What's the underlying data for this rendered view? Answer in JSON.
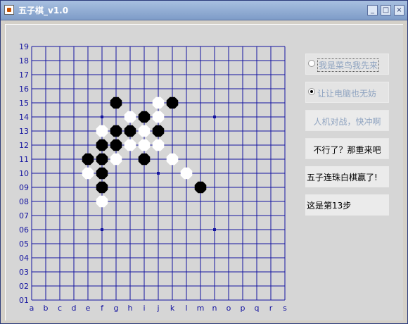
{
  "window": {
    "title": "五子棋_v1.0",
    "minimize": "_",
    "maximize": "□",
    "close": "×"
  },
  "board": {
    "size": 19,
    "row_labels": [
      "19",
      "18",
      "17",
      "16",
      "15",
      "14",
      "13",
      "12",
      "11",
      "10",
      "09",
      "08",
      "07",
      "06",
      "05",
      "04",
      "03",
      "02",
      "01"
    ],
    "col_labels": [
      "a",
      "b",
      "c",
      "d",
      "e",
      "f",
      "g",
      "h",
      "i",
      "j",
      "k",
      "l",
      "m",
      "n",
      "o",
      "p",
      "q",
      "r",
      "s"
    ],
    "line_color": "#1414a0",
    "star_points": [
      "f14",
      "n14",
      "j10",
      "f6",
      "n6"
    ],
    "stones": [
      {
        "pos": "g15",
        "color": "black"
      },
      {
        "pos": "j15",
        "color": "white"
      },
      {
        "pos": "k15",
        "color": "black"
      },
      {
        "pos": "h14",
        "color": "white"
      },
      {
        "pos": "i14",
        "color": "black"
      },
      {
        "pos": "j14",
        "color": "white"
      },
      {
        "pos": "f13",
        "color": "white"
      },
      {
        "pos": "g13",
        "color": "black"
      },
      {
        "pos": "h13",
        "color": "black"
      },
      {
        "pos": "i13",
        "color": "white"
      },
      {
        "pos": "j13",
        "color": "black"
      },
      {
        "pos": "f12",
        "color": "black"
      },
      {
        "pos": "g12",
        "color": "black"
      },
      {
        "pos": "h12",
        "color": "white"
      },
      {
        "pos": "i12",
        "color": "white"
      },
      {
        "pos": "j12",
        "color": "white"
      },
      {
        "pos": "e11",
        "color": "black"
      },
      {
        "pos": "f11",
        "color": "black"
      },
      {
        "pos": "g11",
        "color": "white"
      },
      {
        "pos": "i11",
        "color": "black"
      },
      {
        "pos": "k11",
        "color": "white"
      },
      {
        "pos": "e10",
        "color": "white"
      },
      {
        "pos": "f10",
        "color": "black"
      },
      {
        "pos": "l10",
        "color": "white"
      },
      {
        "pos": "f9",
        "color": "black"
      },
      {
        "pos": "m9",
        "color": "black"
      },
      {
        "pos": "f8",
        "color": "white"
      }
    ]
  },
  "controls": {
    "radio_player_first": "我是菜鸟我先来",
    "radio_computer_first": "让让电脑也无妨",
    "btn_start": "人机对战，快冲啊",
    "btn_restart": "不行了？那重来吧"
  },
  "status": {
    "message": "五子连珠白棋赢了!",
    "step": "这是第13步"
  }
}
